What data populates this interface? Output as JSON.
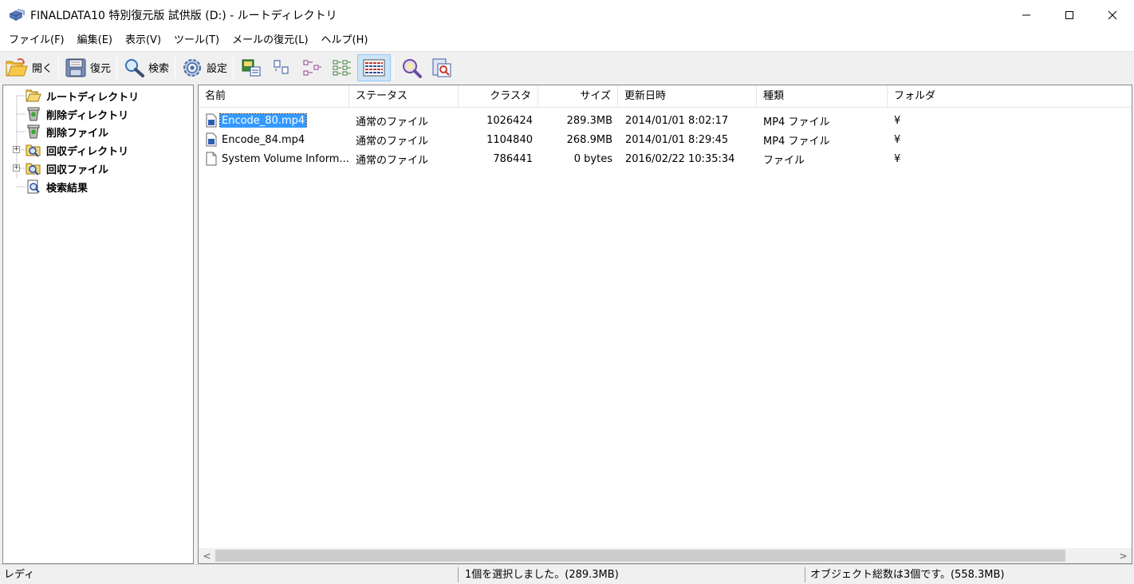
{
  "window": {
    "title": "FINALDATA10 特別復元版 試供版 (D:) - ルートディレクトリ",
    "controls": [
      "minimize-icon",
      "maximize-icon",
      "close-icon"
    ]
  },
  "menubar": {
    "items": [
      "ファイル(F)",
      "編集(E)",
      "表示(V)",
      "ツール(T)",
      "メールの復元(L)",
      "ヘルプ(H)"
    ]
  },
  "toolbar": {
    "open_label": "開く",
    "restore_label": "復元",
    "search_label": "検索",
    "settings_label": "設定",
    "icons": [
      "folder-open-icon",
      "save-disk-icon",
      "magnifier-icon",
      "gear-icon",
      "large-icons-view-icon",
      "small-icons-view-icon",
      "list-view-icon",
      "tree-view-icon",
      "details-view-icon",
      "find-icon",
      "file-preview-icon"
    ],
    "active_view": "details"
  },
  "tree": {
    "items": [
      {
        "label": "ルートディレクトリ",
        "icon": "folder-open-icon"
      },
      {
        "label": "削除ディレクトリ",
        "icon": "recycle-bin-icon"
      },
      {
        "label": "削除ファイル",
        "icon": "recycle-bin-icon"
      },
      {
        "label": "回収ディレクトリ",
        "icon": "folder-search-icon",
        "expandable": true
      },
      {
        "label": "回収ファイル",
        "icon": "folder-search-icon",
        "expandable": true
      },
      {
        "label": "検索結果",
        "icon": "search-document-icon"
      }
    ]
  },
  "list": {
    "columns": [
      "名前",
      "ステータス",
      "クラスタ",
      "サイズ",
      "更新日時",
      "種類",
      "フォルダ"
    ],
    "rows": [
      {
        "name": "Encode_80.mp4",
        "status": "通常のファイル",
        "cluster": "1026424",
        "size": "289.3MB",
        "modified": "2014/01/01 8:02:17",
        "type": "MP4 ファイル",
        "folder": "¥",
        "selected": true
      },
      {
        "name": "Encode_84.mp4",
        "status": "通常のファイル",
        "cluster": "1104840",
        "size": "268.9MB",
        "modified": "2014/01/01 8:29:45",
        "type": "MP4 ファイル",
        "folder": "¥",
        "selected": false
      },
      {
        "name": "System Volume Inform...",
        "status": "通常のファイル",
        "cluster": "786441",
        "size": "0 bytes",
        "modified": "2016/02/22 10:35:34",
        "type": "ファイル",
        "folder": "¥",
        "selected": false
      }
    ]
  },
  "scrollbar": {
    "left_arrow": "<",
    "right_arrow": ">"
  },
  "statusbar": {
    "ready": "レディ",
    "selection": "1個を選択しました。(289.3MB)",
    "total": "オブジェクト総数は3個です。(558.3MB)"
  },
  "colors": {
    "selection": "#3399ff",
    "toolbar_bg": "#f0f0f0",
    "active_tool": "#cce4f7"
  }
}
